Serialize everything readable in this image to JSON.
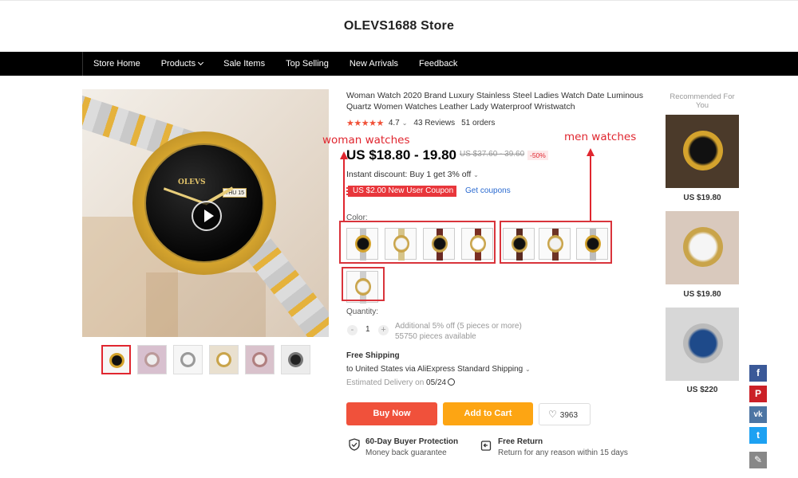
{
  "store": {
    "title": "OLEVS1688 Store"
  },
  "nav": {
    "items": [
      "Store Home",
      "Products",
      "Sale Items",
      "Top Selling",
      "New Arrivals",
      "Feedback"
    ]
  },
  "product": {
    "title": "Woman Watch 2020 Brand Luxury Stainless Steel Ladies Watch Date Luminous Quartz Women Watches Leather Lady Waterproof Wristwatch",
    "stars": "★★★★★",
    "rating": "4.7",
    "reviews": "43 Reviews",
    "orders": "51 orders",
    "price": "US $18.80 - 19.80",
    "old_price": "US $37.60 - 39.60",
    "discount": "-50%",
    "instant_discount": "Instant discount: Buy 1 get 3% off",
    "coupon": "US $2.00 New User Coupon",
    "get_coupons": "Get coupons",
    "color_label": "Color:",
    "dial_logo": "OLEVS",
    "dial_date": "THU 15"
  },
  "annotations": {
    "woman": "woman watches",
    "men": "men watches"
  },
  "quantity": {
    "label": "Quantity:",
    "minus": "-",
    "value": "1",
    "plus": "+",
    "info_line1": "Additional 5% off (5 pieces or more)",
    "info_line2": "55750 pieces available"
  },
  "shipping": {
    "title": "Free Shipping",
    "to": "to United States via AliExpress Standard Shipping",
    "est_prefix": "Estimated Delivery on",
    "est_date": "05/24"
  },
  "actions": {
    "buy_now": "Buy Now",
    "add_to_cart": "Add to Cart",
    "wishlist_count": "3963"
  },
  "protection": {
    "buyer_title": "60-Day Buyer Protection",
    "buyer_sub": "Money back guarantee",
    "return_title": "Free Return",
    "return_sub": "Return for any reason within 15 days"
  },
  "recommended": {
    "title": "Recommended For You",
    "items": [
      {
        "price": "US $19.80"
      },
      {
        "price": "US $19.80"
      },
      {
        "price": "US $220"
      }
    ]
  },
  "share": {
    "facebook": "f",
    "pinterest": "P",
    "vk": "vk",
    "twitter": "t",
    "edit": "✎"
  },
  "icons": {
    "chevron": "chevron-down-icon",
    "play": "play-icon",
    "heart": "heart-icon",
    "shield": "shield-icon",
    "return": "return-icon",
    "clock": "clock-icon"
  },
  "colors": {
    "accent_red": "#e0262f",
    "buy_now": "#f0513b",
    "add_to_cart": "#fda513",
    "link": "#2a6ad0"
  }
}
